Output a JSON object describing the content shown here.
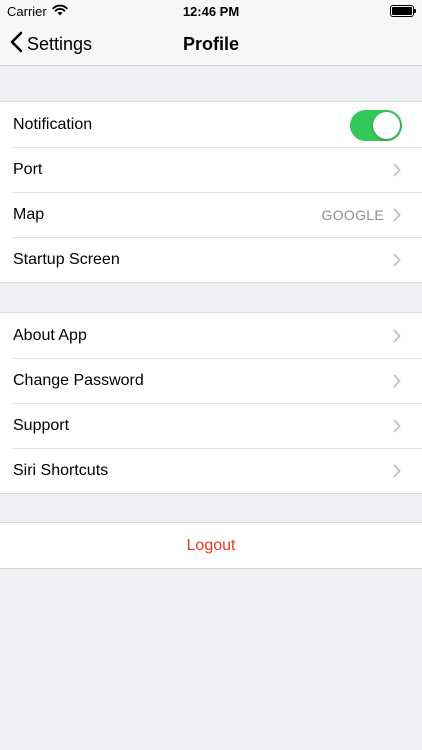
{
  "status_bar": {
    "carrier": "Carrier",
    "time": "12:46 PM"
  },
  "nav": {
    "back_label": "Settings",
    "title": "Profile"
  },
  "section1": {
    "notification": {
      "label": "Notification",
      "enabled": true
    },
    "port": {
      "label": "Port"
    },
    "map": {
      "label": "Map",
      "value": "GOOGLE"
    },
    "startup_screen": {
      "label": "Startup Screen"
    }
  },
  "section2": {
    "items": [
      {
        "label": "About App"
      },
      {
        "label": "Change Password"
      },
      {
        "label": "Support"
      },
      {
        "label": "Siri Shortcuts"
      }
    ]
  },
  "logout": {
    "label": "Logout"
  },
  "colors": {
    "accent_green": "#34c759",
    "logout_red": "#e2361f",
    "background": "#efeff4"
  }
}
